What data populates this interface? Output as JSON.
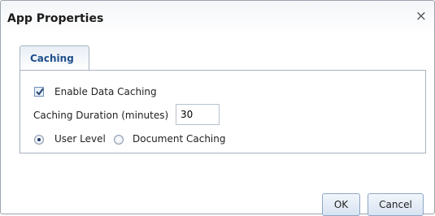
{
  "dialog": {
    "title": "App Properties",
    "close_glyph": "×"
  },
  "tabs": [
    {
      "label": "Caching",
      "selected": true
    }
  ],
  "caching": {
    "enable_label": "Enable Data Caching",
    "enable_checked": true,
    "duration_label": "Caching Duration (minutes)",
    "duration_value": "30",
    "radio_user_label": "User Level",
    "radio_user_selected": true,
    "radio_doc_label": "Document Caching",
    "radio_doc_selected": false
  },
  "buttons": {
    "ok": "OK",
    "cancel": "Cancel"
  },
  "icons": {
    "close": "close-icon",
    "checkbox": "checkbox-checked-icon"
  },
  "colors": {
    "tab_text": "#1e4f8c",
    "border": "#a9b3c0",
    "button_border": "#8ea6c6"
  }
}
